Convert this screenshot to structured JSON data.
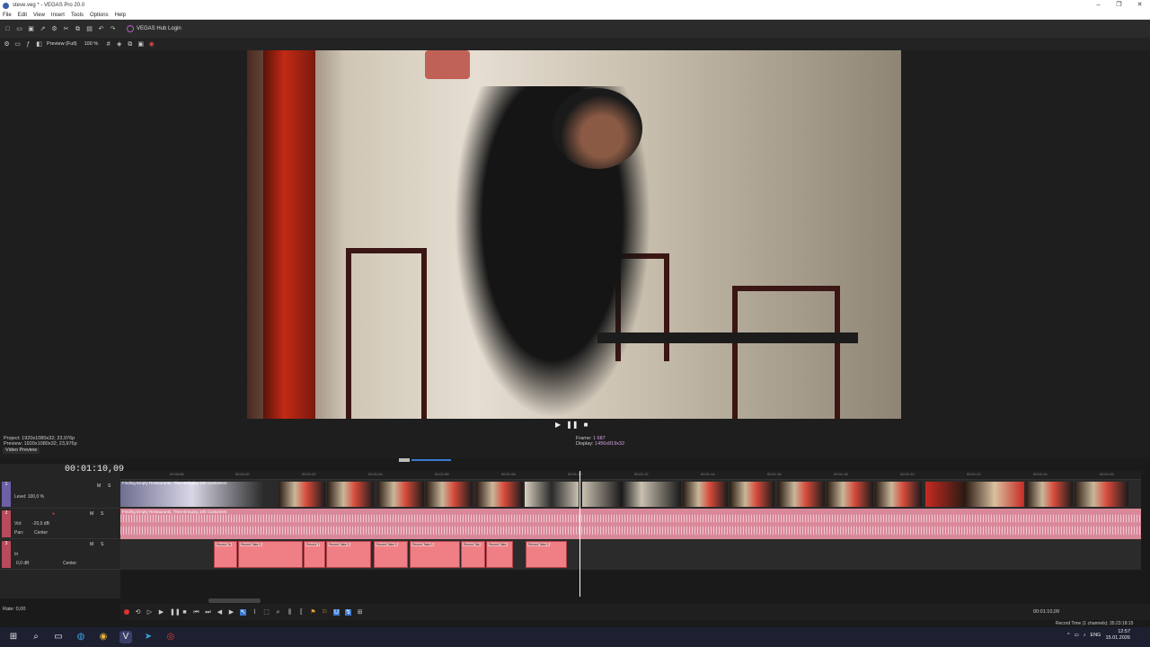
{
  "window": {
    "title": "steve.veg * - VEGAS Pro 20.0",
    "min": "–",
    "max": "❐",
    "close": "✕"
  },
  "menu": [
    "File",
    "Edit",
    "View",
    "Insert",
    "Tools",
    "Options",
    "Help"
  ],
  "toolbar": {
    "hub_label": "VEGAS Hub Login"
  },
  "preview_toolbar": {
    "quality": "Preview (Full)",
    "zoom": "100 %"
  },
  "preview": {
    "project_info": "Project:  1920x1080x32; 23,976p",
    "preview_info": "Preview:  1920x1080x32; 23,976p",
    "tab": "Video Preview",
    "frame_label": "Frame:",
    "frame_value": "1 687",
    "display_label": "Display:",
    "display_value": "1456x819x32"
  },
  "timeline": {
    "timecode": "00:01:10,09",
    "ruler_ticks": [
      "00:00:58",
      "00:01:00",
      "00:01:02",
      "00:01:04",
      "00:01:06",
      "00:01:08",
      "00:01:10",
      "00:01:12",
      "00:01:14",
      "00:01:16",
      "00:01:18",
      "00:01:20",
      "00:01:22",
      "00:01:24",
      "00:01:26"
    ],
    "video_track": {
      "number": "1",
      "level": "Level: 100,0 %",
      "clip_title": "Finding Empty Restaurants, Then Bringing 100 Customers"
    },
    "audio_track1": {
      "number": "2",
      "vol": "Vol:",
      "vol_value": "-20,0 dB",
      "pan": "Pan:",
      "pan_value": "Center",
      "clip_title": "Finding Empty Restaurants, Then Bringing 100 Customers"
    },
    "audio_track2": {
      "number": "3",
      "in": "In",
      "gain": "0,0 dB",
      "pan_value": "Center"
    },
    "record_clips": [
      "Record Ta",
      "Record Take 3",
      "Record T",
      "Record Take 3",
      "Record Take 3",
      "Record Take 3",
      "Record Tak",
      "Record Take",
      "Record Take 3"
    ],
    "record_sub": "Track 3 - 2 3,3"
  },
  "transport": {
    "rate": "Rate: 0,00",
    "timecode_right": "00:01:10,09",
    "record_time": "Record Time (1 channels): 35:23:18:15"
  },
  "taskbar": {
    "lang": "ENG",
    "time": "12:57",
    "date": "15.01.2026"
  },
  "colors": {
    "accent": "#6d5fa8",
    "audio_clip": "#ef7f85",
    "audio_track": "#d9889a"
  }
}
